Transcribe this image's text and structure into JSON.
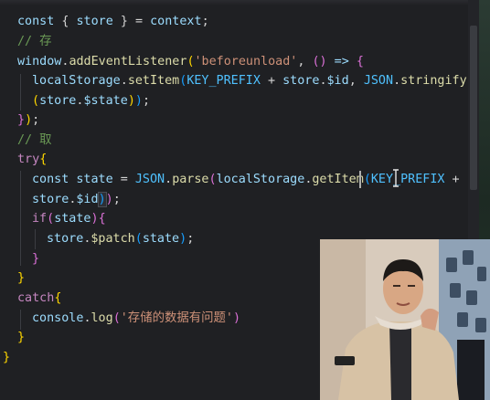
{
  "code": {
    "lines": [
      {
        "tokens": [
          [
            "const",
            "tk-var"
          ],
          [
            " { ",
            "tk-punc"
          ],
          [
            "store",
            "tk-var"
          ],
          [
            " } = ",
            "tk-punc"
          ],
          [
            "context",
            "tk-var"
          ],
          [
            ";",
            "tk-punc"
          ]
        ]
      },
      {
        "tokens": [
          [
            "// 存",
            "tk-cmt"
          ]
        ]
      },
      {
        "tokens": [
          [
            "window",
            "tk-var"
          ],
          [
            ".",
            "tk-punc"
          ],
          [
            "addEventListener",
            "tk-fn"
          ],
          [
            "(",
            "tk-br1"
          ],
          [
            "'beforeunload'",
            "tk-str"
          ],
          [
            ", ",
            "tk-punc"
          ],
          [
            "()",
            "tk-br2"
          ],
          [
            " => ",
            "tk-var"
          ],
          [
            "{",
            "tk-br2"
          ]
        ]
      },
      {
        "tokens": [
          [
            "localStorage",
            "tk-var"
          ],
          [
            ".",
            "tk-punc"
          ],
          [
            "setItem",
            "tk-fn"
          ],
          [
            "(",
            "tk-br3"
          ],
          [
            "KEY_PREFIX",
            "tk-const"
          ],
          [
            " + ",
            "tk-punc"
          ],
          [
            "store",
            "tk-var"
          ],
          [
            ".",
            "tk-punc"
          ],
          [
            "$id",
            "tk-var"
          ],
          [
            ", ",
            "tk-punc"
          ],
          [
            "JSON",
            "tk-const"
          ],
          [
            ".",
            "tk-punc"
          ],
          [
            "stringify",
            "tk-fn"
          ]
        ]
      },
      {
        "tokens": [
          [
            "(",
            "tk-br1"
          ],
          [
            "store",
            "tk-var"
          ],
          [
            ".",
            "tk-punc"
          ],
          [
            "$state",
            "tk-var"
          ],
          [
            ")",
            "tk-br1"
          ],
          [
            ")",
            "tk-br3"
          ],
          [
            ";",
            "tk-punc"
          ]
        ]
      },
      {
        "tokens": [
          [
            "}",
            "tk-br2"
          ],
          [
            ")",
            "tk-br1"
          ],
          [
            ";",
            "tk-punc"
          ]
        ]
      },
      {
        "tokens": [
          [
            "// 取",
            "tk-cmt"
          ]
        ]
      },
      {
        "tokens": [
          [
            "try",
            "tk-key"
          ],
          [
            "{",
            "tk-br1"
          ]
        ]
      },
      {
        "tokens": [
          [
            "const",
            "tk-var"
          ],
          [
            " ",
            "tk-punc"
          ],
          [
            "state",
            "tk-var"
          ],
          [
            " = ",
            "tk-punc"
          ],
          [
            "JSON",
            "tk-const"
          ],
          [
            ".",
            "tk-punc"
          ],
          [
            "parse",
            "tk-fn"
          ],
          [
            "(",
            "tk-br2"
          ],
          [
            "localStorage",
            "tk-var"
          ],
          [
            ".",
            "tk-punc"
          ],
          [
            "getItem",
            "tk-fn"
          ],
          [
            "(",
            "tk-br3"
          ],
          [
            "KEY_PREFIX",
            "tk-const"
          ],
          [
            " +",
            "tk-punc"
          ]
        ]
      },
      {
        "tokens": [
          [
            "store",
            "tk-var"
          ],
          [
            ".",
            "tk-punc"
          ],
          [
            "$id",
            "tk-var"
          ],
          [
            ")",
            "tk-br3"
          ],
          [
            ")",
            "tk-br2"
          ],
          [
            ";",
            "tk-punc"
          ]
        ]
      },
      {
        "tokens": [
          [
            "if",
            "tk-key"
          ],
          [
            "(",
            "tk-br2"
          ],
          [
            "state",
            "tk-var"
          ],
          [
            ")",
            "tk-br2"
          ],
          [
            "{",
            "tk-br2"
          ]
        ]
      },
      {
        "tokens": [
          [
            "store",
            "tk-var"
          ],
          [
            ".",
            "tk-punc"
          ],
          [
            "$patch",
            "tk-fn"
          ],
          [
            "(",
            "tk-br3"
          ],
          [
            "state",
            "tk-var"
          ],
          [
            ")",
            "tk-br3"
          ],
          [
            ";",
            "tk-punc"
          ]
        ]
      },
      {
        "tokens": [
          [
            "}",
            "tk-br2"
          ]
        ]
      },
      {
        "tokens": [
          [
            "}",
            "tk-br1"
          ]
        ]
      },
      {
        "tokens": [
          [
            "catch",
            "tk-key"
          ],
          [
            "{",
            "tk-br1"
          ]
        ]
      },
      {
        "tokens": [
          [
            "console",
            "tk-var"
          ],
          [
            ".",
            "tk-punc"
          ],
          [
            "log",
            "tk-fn"
          ],
          [
            "(",
            "tk-br2"
          ],
          [
            "'存储的数据有问题'",
            "tk-str"
          ],
          [
            ")",
            "tk-br2"
          ]
        ]
      },
      {
        "tokens": [
          [
            "}",
            "tk-br1"
          ]
        ]
      },
      {
        "tokens": [
          [
            "}",
            "tk-br1"
          ]
        ]
      }
    ]
  },
  "colors": {
    "background": "#1f2023",
    "comment": "#6a9955",
    "string": "#ce9178",
    "function": "#dcdcaa",
    "variable": "#9cdcfe",
    "keyword": "#c586c0"
  },
  "webcam": {
    "icon": "presenter-video-overlay"
  }
}
